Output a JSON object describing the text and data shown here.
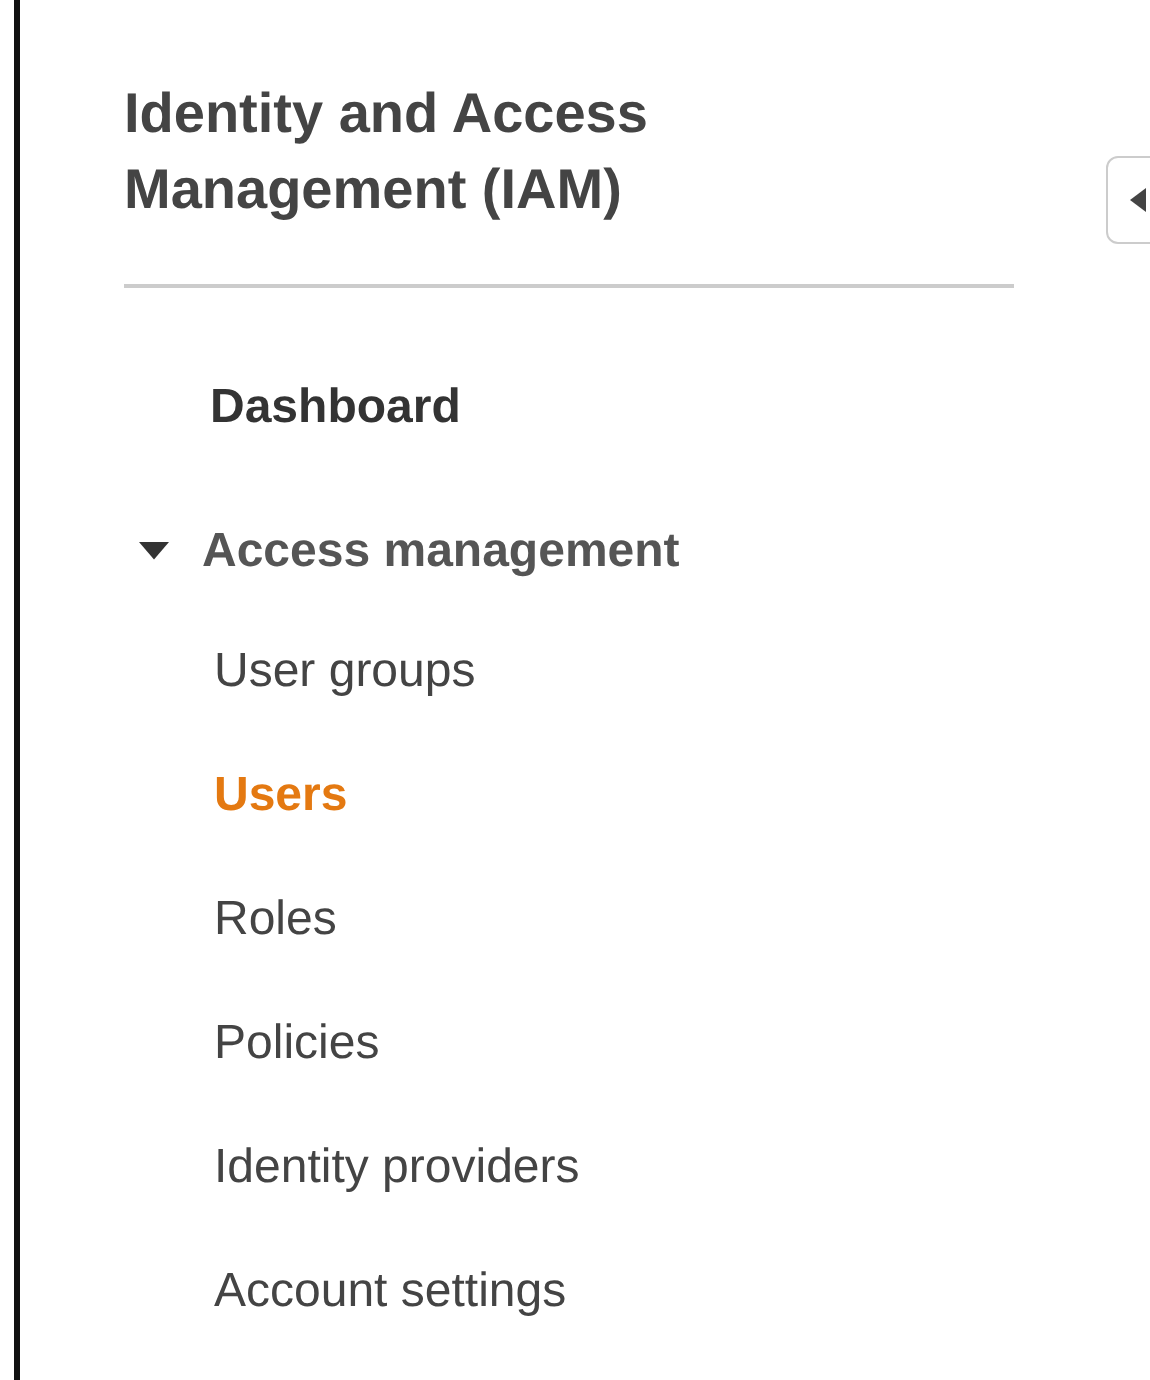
{
  "sidebar": {
    "title": "Identity and Access Management (IAM)",
    "items": [
      {
        "kind": "link",
        "label": "Dashboard"
      },
      {
        "kind": "section",
        "label": "Access management",
        "expanded": true,
        "children": [
          {
            "label": "User groups",
            "selected": false
          },
          {
            "label": "Users",
            "selected": true
          },
          {
            "label": "Roles",
            "selected": false
          },
          {
            "label": "Policies",
            "selected": false
          },
          {
            "label": "Identity providers",
            "selected": false
          },
          {
            "label": "Account settings",
            "selected": false
          }
        ]
      }
    ]
  }
}
